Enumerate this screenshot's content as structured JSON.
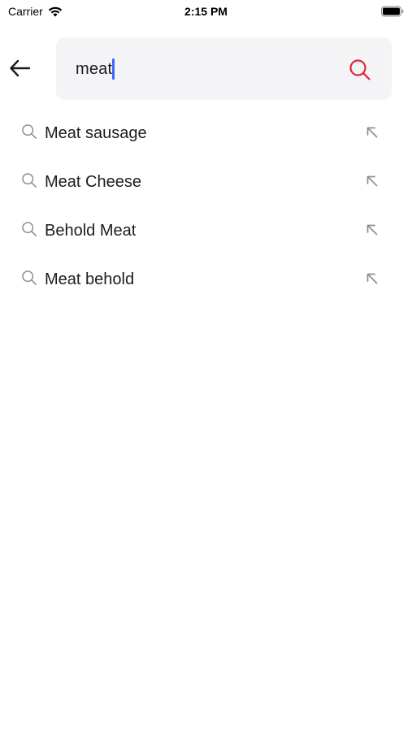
{
  "status_bar": {
    "carrier": "Carrier",
    "time": "2:15 PM"
  },
  "search": {
    "value": "meat",
    "accent_color": "#e0263a",
    "caret_color": "#3e6bf0"
  },
  "icons": {
    "back": "arrow-left-icon",
    "search": "search-icon",
    "suggestion": "search-icon",
    "fill": "arrow-up-left-icon"
  },
  "suggestions": [
    {
      "label": "Meat sausage"
    },
    {
      "label": "Meat Cheese"
    },
    {
      "label": "Behold Meat"
    },
    {
      "label": "Meat behold"
    }
  ]
}
